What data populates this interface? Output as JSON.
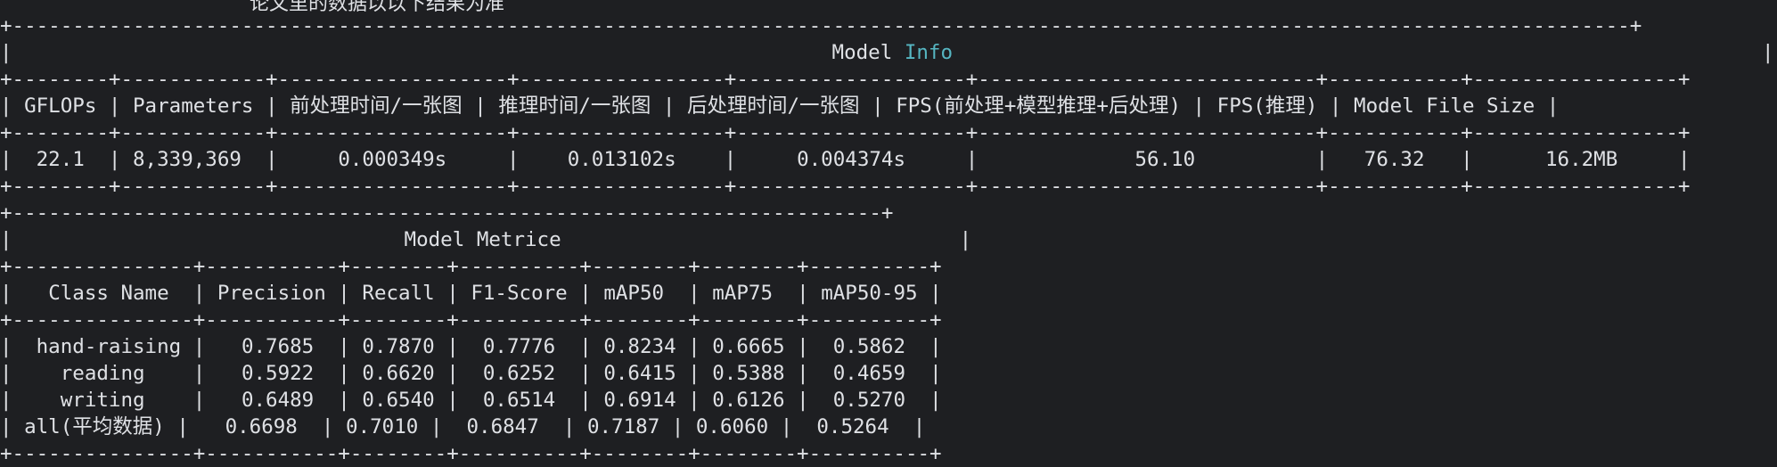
{
  "header_text": "论文里的数据以以下结果为准",
  "model_info": {
    "title_prefix": "Model ",
    "title_highlight": "Info",
    "columns": [
      "GFLOPs",
      "Parameters",
      "前处理时间/一张图",
      "推理时间/一张图",
      "后处理时间/一张图",
      "FPS(前处理+模型推理+后处理)",
      "FPS(推理)",
      "Model File Size"
    ],
    "values": [
      "22.1",
      "8,339,369",
      "0.000349s",
      "0.013102s",
      "0.004374s",
      "56.10",
      "76.32",
      "16.2MB"
    ]
  },
  "model_metrics": {
    "title": "Model Metrice",
    "columns": [
      "Class Name",
      "Precision",
      "Recall",
      "F1-Score",
      "mAP50",
      "mAP75",
      "mAP50-95"
    ],
    "rows": [
      [
        "hand-raising",
        "0.7685",
        "0.7870",
        "0.7776",
        "0.8234",
        "0.6665",
        "0.5862"
      ],
      [
        "reading",
        "0.5922",
        "0.6620",
        "0.6252",
        "0.6415",
        "0.5388",
        "0.4659"
      ],
      [
        "writing",
        "0.6489",
        "0.6540",
        "0.6514",
        "0.6914",
        "0.6126",
        "0.5270"
      ],
      [
        "all(平均数据)",
        "0.6698",
        "0.7010",
        "0.6847",
        "0.7187",
        "0.6060",
        "0.5264"
      ]
    ]
  },
  "colors": {
    "background": "#1e1f22",
    "text": "#dfe1e5",
    "highlight": "#56b6c2"
  }
}
